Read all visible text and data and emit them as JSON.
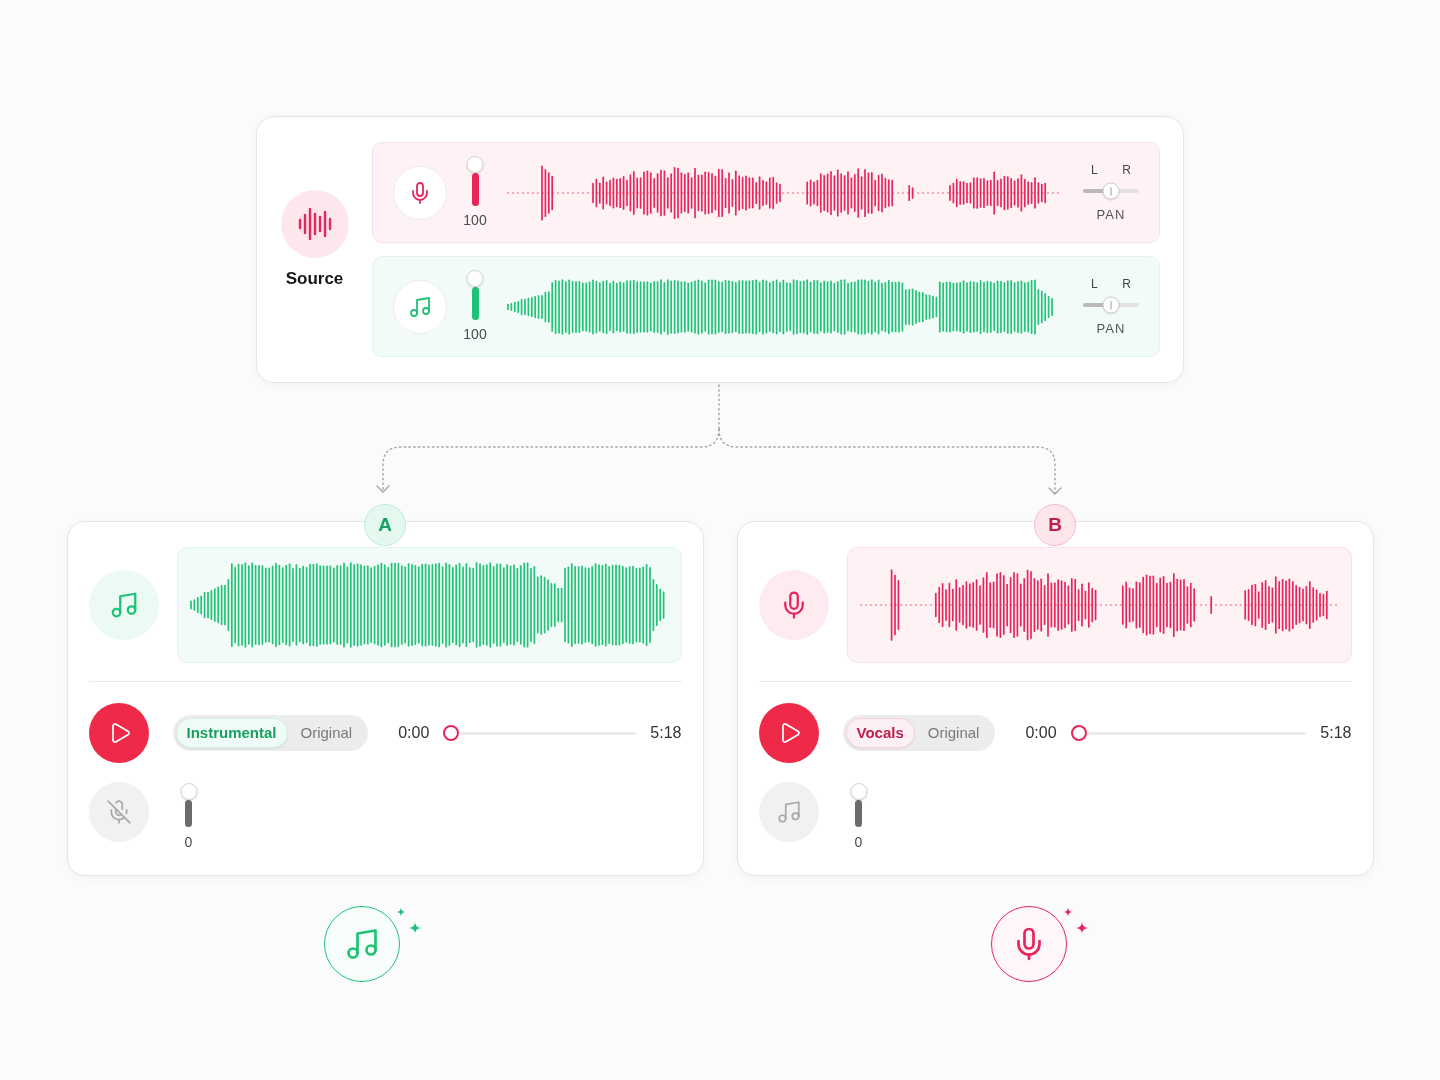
{
  "source": {
    "label": "Source",
    "tracks": [
      {
        "kind": "vocals",
        "color": "#e8255b",
        "level": 1,
        "reading": "100",
        "pan": {
          "left": "L",
          "right": "R",
          "label": "PAN",
          "level": 0.5
        }
      },
      {
        "kind": "music",
        "color": "#20c278",
        "level": 1,
        "reading": "100",
        "pan": {
          "left": "L",
          "right": "R",
          "label": "PAN",
          "level": 0.5
        }
      }
    ]
  },
  "outputs": [
    {
      "badge": "A",
      "kind": "music",
      "color": "#20c278",
      "modes": [
        {
          "label": "Instrumental",
          "selected": true
        },
        {
          "label": "Original",
          "selected": false
        }
      ],
      "time_start": "0:00",
      "progress": {
        "level": 0
      },
      "time_end": "5:18",
      "removed_stem": {
        "kind": "mic_off",
        "muted": true,
        "level": 1,
        "reading": "0"
      }
    },
    {
      "badge": "B",
      "kind": "vocals",
      "color": "#e8255b",
      "modes": [
        {
          "label": "Vocals",
          "selected": true
        },
        {
          "label": "Original",
          "selected": false
        }
      ],
      "time_start": "0:00",
      "progress": {
        "level": 0
      },
      "time_end": "5:18",
      "removed_stem": {
        "kind": "music",
        "muted": true,
        "level": 1,
        "reading": "0"
      }
    }
  ]
}
